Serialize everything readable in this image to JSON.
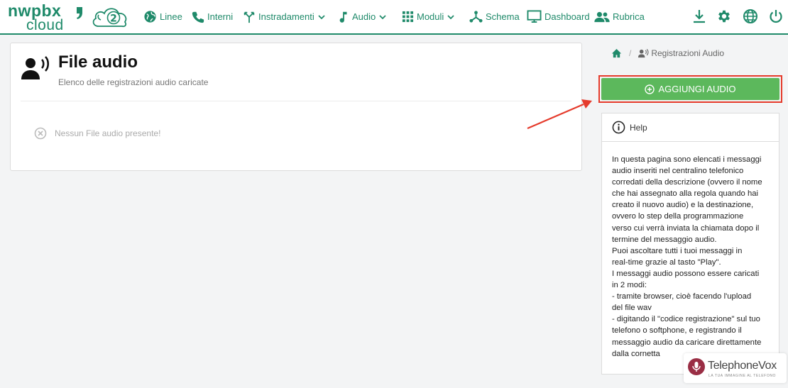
{
  "brand": {
    "logo_line1": "nwpbx",
    "logo_line2": "cloud",
    "cloud_badge": "2",
    "color": "#1f8a6a"
  },
  "nav": {
    "items": [
      {
        "label": "Linee",
        "icon": "globe-icon"
      },
      {
        "label": "Interni",
        "icon": "phone-icon"
      },
      {
        "label": "Instradamenti",
        "icon": "routing-icon",
        "dropdown": true
      },
      {
        "label": "Audio",
        "icon": "music-note-icon",
        "dropdown": true
      },
      {
        "label": "Moduli",
        "icon": "grid-icon",
        "dropdown": true
      },
      {
        "label": "Schema",
        "icon": "schema-icon"
      },
      {
        "label": "Dashboard",
        "icon": "monitor-icon"
      },
      {
        "label": "Rubrica",
        "icon": "contacts-icon"
      }
    ],
    "right_icons": [
      "download-icon",
      "gear-icon",
      "globe-icon",
      "power-icon"
    ]
  },
  "page": {
    "title": "File audio",
    "subtitle": "Elenco delle registrazioni audio caricate",
    "empty_text": "Nessun File audio presente!"
  },
  "breadcrumb": {
    "current": "Registrazioni Audio"
  },
  "actions": {
    "add_label": "AGGIUNGI AUDIO",
    "add_color": "#5cb85c",
    "highlight_color": "#e53b2c"
  },
  "help": {
    "title": "Help",
    "lines": [
      "In questa pagina sono elencati i messaggi",
      "audio inseriti nel centralino telefonico",
      "corredati della descrizione (ovvero il nome",
      "che hai assegnato alla regola quando hai",
      "creato il nuovo audio) e la destinazione,",
      "ovvero lo step della programmazione",
      "verso cui verrà inviata la chiamata dopo il",
      "termine del messaggio audio.",
      "Puoi ascoltare tutti i tuoi messaggi in",
      "real-time grazie al tasto \"Play\".",
      "I messaggi audio possono essere caricati",
      "in 2 modi:",
      "- tramite browser, cioè facendo l'upload",
      "del file wav",
      "- digitando il \"codice registrazione\" sul tuo",
      "telefono o softphone, e registrando il",
      "messaggio audio da caricare direttamente",
      "dalla cornetta"
    ]
  },
  "watermark": {
    "brand": "TelephoneVox",
    "tagline": "LA TUA IMMAGINE AL TELEFONO"
  }
}
